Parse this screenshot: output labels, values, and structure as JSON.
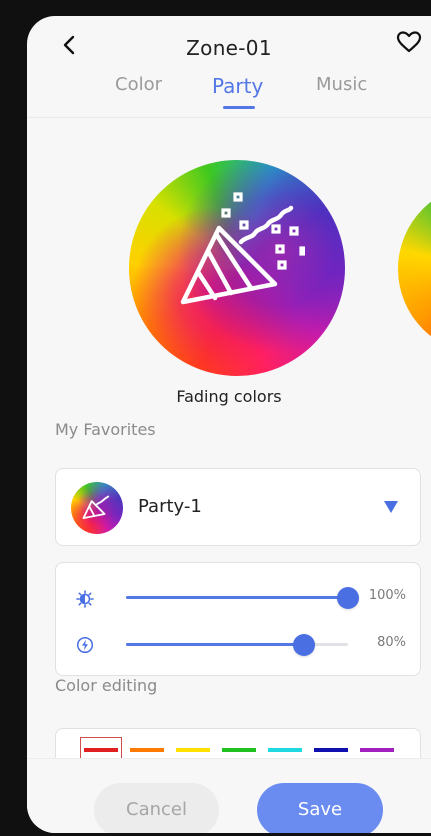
{
  "header": {
    "title": "Zone-01",
    "back_icon": "chevron-left-icon",
    "favorite_icon": "heart-outline-icon"
  },
  "tabs": [
    {
      "label": "Color",
      "active": false
    },
    {
      "label": "Party",
      "active": true
    },
    {
      "label": "Music",
      "active": false
    }
  ],
  "scene": {
    "name": "Fading colors",
    "icon": "party-popper-icon"
  },
  "favorites": {
    "section_title": "My Favorites",
    "selected": "Party-1",
    "dropdown_icon": "caret-down-icon"
  },
  "sliders": {
    "brightness": {
      "icon": "brightness-icon",
      "value_label": "100%",
      "value": 1.0
    },
    "speed": {
      "icon": "speed-icon",
      "value_label": "80%",
      "value": 0.8
    }
  },
  "color_editing": {
    "section_title": "Color editing",
    "swatches": [
      "#e02020",
      "#ff7a00",
      "#ffe000",
      "#20c020",
      "#20d8e0",
      "#1010b0",
      "#a020c0"
    ],
    "selected_index": 0
  },
  "actions": {
    "cancel_label": "Cancel",
    "save_label": "Save"
  },
  "colors": {
    "accent": "#5477e6",
    "save_button": "#6a8cf0",
    "cancel_button": "#ececec"
  }
}
